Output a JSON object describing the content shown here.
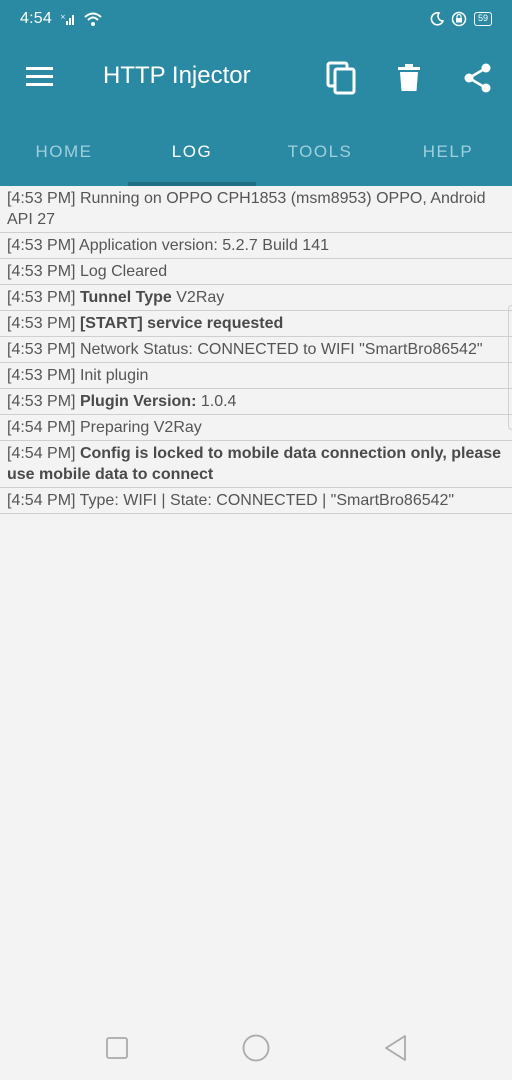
{
  "status_bar": {
    "time": "4:54",
    "battery": "59",
    "icons": [
      "signal-icon",
      "wifi-icon",
      "moon-icon",
      "vpn-lock-icon",
      "battery-icon"
    ]
  },
  "app_bar": {
    "title": "HTTP Injector",
    "actions": [
      "copy-icon",
      "delete-icon",
      "share-icon"
    ],
    "color": "#2a8aa3"
  },
  "tabs": [
    {
      "label": "HOME",
      "active": false
    },
    {
      "label": "LOG",
      "active": true
    },
    {
      "label": "TOOLS",
      "active": false
    },
    {
      "label": "HELP",
      "active": false
    }
  ],
  "log": [
    {
      "time": "[4:53 PM]",
      "bold": "",
      "text": "Running on OPPO CPH1853 (msm8953) OPPO, Android API 27"
    },
    {
      "time": "[4:53 PM]",
      "bold": "",
      "text": "Application version: 5.2.7 Build 141"
    },
    {
      "time": "[4:53 PM]",
      "bold": "",
      "text": "Log Cleared"
    },
    {
      "time": "[4:53 PM]",
      "bold": "Tunnel Type",
      "text": "V2Ray"
    },
    {
      "time": "[4:53 PM]",
      "bold": "[START] service requested",
      "text": ""
    },
    {
      "time": "[4:53 PM]",
      "bold": "",
      "text": "Network Status: CONNECTED to WIFI \"SmartBro86542\""
    },
    {
      "time": "[4:53 PM]",
      "bold": "",
      "text": "Init plugin"
    },
    {
      "time": "[4:53 PM]",
      "bold": "Plugin Version:",
      "text": "1.0.4"
    },
    {
      "time": "[4:54 PM]",
      "bold": "",
      "text": "Preparing V2Ray"
    },
    {
      "time": "[4:54 PM]",
      "bold": "Config is locked to mobile data connection only, please use mobile data to connect",
      "text": ""
    },
    {
      "time": "[4:54 PM]",
      "bold": "",
      "text": "Type: WIFI | State: CONNECTED | \"SmartBro86542\""
    }
  ],
  "nav_bar": [
    "recents-square-icon",
    "home-circle-icon",
    "back-triangle-icon"
  ]
}
